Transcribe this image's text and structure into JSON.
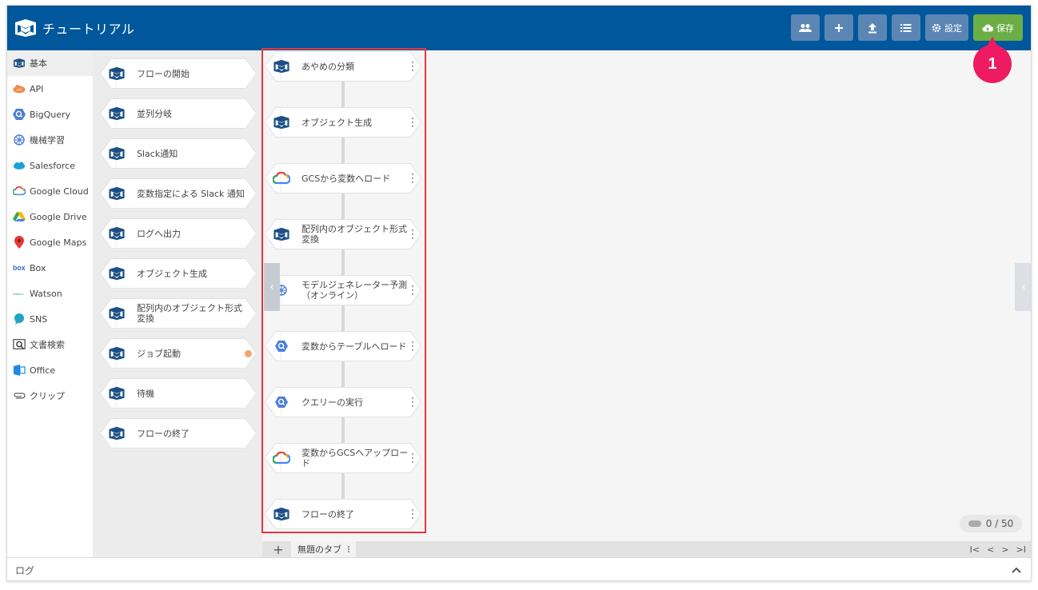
{
  "header": {
    "title": "チュートリアル",
    "buttons": [
      {
        "name": "users",
        "icon": "users-icon",
        "label": ""
      },
      {
        "name": "add",
        "icon": "plus-icon",
        "label": ""
      },
      {
        "name": "upload",
        "icon": "upload-icon",
        "label": ""
      },
      {
        "name": "list",
        "icon": "list-icon",
        "label": ""
      },
      {
        "name": "settings",
        "icon": "gear-icon",
        "label": "設定"
      },
      {
        "name": "save",
        "icon": "cloud-upload-icon",
        "label": "保存"
      }
    ]
  },
  "categories": [
    {
      "label": "基本",
      "icon": "blocks-icon",
      "active": true
    },
    {
      "label": "API",
      "icon": "api-icon"
    },
    {
      "label": "BigQuery",
      "icon": "bigquery-icon"
    },
    {
      "label": "機械学習",
      "icon": "brain-icon"
    },
    {
      "label": "Salesforce",
      "icon": "salesforce-icon"
    },
    {
      "label": "Google Cloud",
      "icon": "google-cloud-icon"
    },
    {
      "label": "Google Drive",
      "icon": "google-drive-icon"
    },
    {
      "label": "Google Maps",
      "icon": "map-pin-icon"
    },
    {
      "label": "Box",
      "icon": "box-icon"
    },
    {
      "label": "Watson",
      "icon": "watson-icon"
    },
    {
      "label": "SNS",
      "icon": "chat-icon"
    },
    {
      "label": "文書検索",
      "icon": "document-search-icon"
    },
    {
      "label": "Office",
      "icon": "office-icon"
    },
    {
      "label": "クリップ",
      "icon": "paperclip-icon"
    }
  ],
  "palette": [
    {
      "label": "フローの開始"
    },
    {
      "label": "並列分岐"
    },
    {
      "label": "Slack通知"
    },
    {
      "label": "変数指定による Slack 通知"
    },
    {
      "label": "ログへ出力"
    },
    {
      "label": "オブジェクト生成"
    },
    {
      "label": "配列内のオブジェクト形式変換"
    },
    {
      "label": "ジョブ起動",
      "badge": true
    },
    {
      "label": "待機"
    },
    {
      "label": "フローの終了"
    }
  ],
  "flow": [
    {
      "label": "あやめの分類",
      "icon": "blocks-icon"
    },
    {
      "label": "オブジェクト生成",
      "icon": "blocks-icon"
    },
    {
      "label": "GCSから変数へロード",
      "icon": "google-cloud-icon"
    },
    {
      "label": "配列内のオブジェクト形式変換",
      "icon": "blocks-icon"
    },
    {
      "label": "モデルジェネレーター予測（オンライン）",
      "icon": "brain-icon"
    },
    {
      "label": "変数からテーブルへロード",
      "icon": "bigquery-icon"
    },
    {
      "label": "クエリーの実行",
      "icon": "bigquery-icon"
    },
    {
      "label": "変数からGCSへアップロード",
      "icon": "google-cloud-icon"
    },
    {
      "label": "フローの終了",
      "icon": "blocks-icon"
    }
  ],
  "annotation": {
    "number": "1"
  },
  "counter": {
    "text": "0 / 50"
  },
  "tabs": {
    "add_label": "+",
    "items": [
      {
        "label": "無題のタブ"
      }
    ]
  },
  "pager": {
    "first": "I<",
    "prev": "<",
    "next": ">",
    "last": ">I"
  },
  "log": {
    "label": "ログ"
  },
  "colors": {
    "header": "#00579b",
    "save": "#6aae45",
    "highlight": "#e5373b",
    "badge": "#ee1b63"
  }
}
